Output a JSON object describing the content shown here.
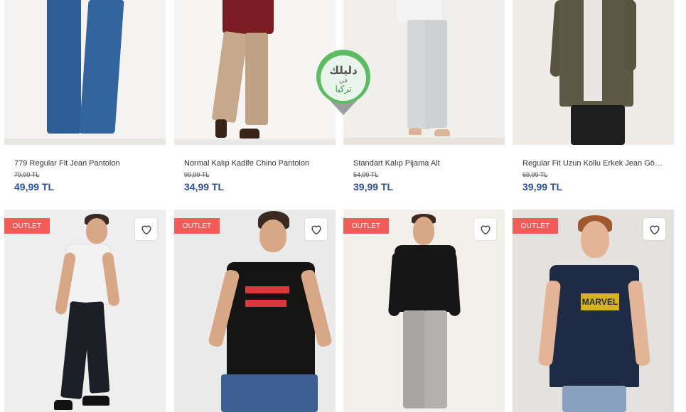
{
  "products_row1": [
    {
      "name": "779 Regular Fit Jean Pantolon",
      "old_price": "79,99 TL",
      "price": "49,99 TL"
    },
    {
      "name": "Normal Kalıp Kadife Chino Pantolon",
      "old_price": "99,99 TL",
      "price": "34,99 TL"
    },
    {
      "name": "Standart Kalıp Pijama Alt",
      "old_price": "54,99 TL",
      "price": "39,99 TL"
    },
    {
      "name": "Regular Fit Uzun Kollu Erkek Jean Gömlek",
      "old_price": "69,99 TL",
      "price": "39,99 TL"
    }
  ],
  "products_row2": [
    {
      "badge": "OUTLET",
      "fav_icon": "heart-icon"
    },
    {
      "badge": "OUTLET",
      "fav_icon": "heart-icon"
    },
    {
      "badge": "OUTLET",
      "fav_icon": "heart-icon"
    },
    {
      "badge": "OUTLET",
      "fav_icon": "heart-icon"
    }
  ],
  "watermark": {
    "line1": "دليلك",
    "line2": "في",
    "line3": "تركيا"
  },
  "tshirt_print": "MARVEL",
  "colors": {
    "accent": "#2a4fa8",
    "badge": "#f25b57",
    "watermark_green": "#4caf50"
  }
}
